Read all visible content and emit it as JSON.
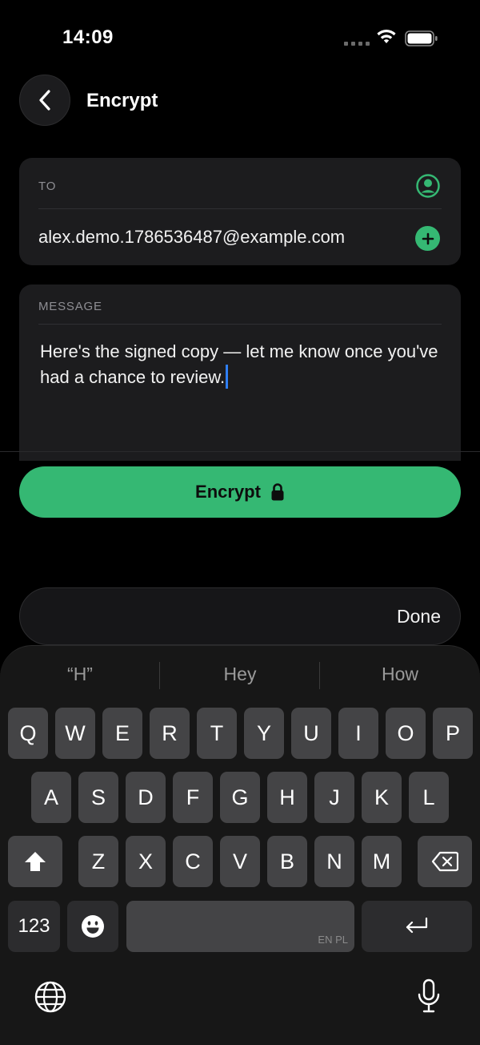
{
  "status_bar": {
    "time": "14:09"
  },
  "header": {
    "title": "Encrypt"
  },
  "to_card": {
    "label": "TO",
    "recipient": "alex.demo.1786536487@example.com"
  },
  "message_card": {
    "label": "MESSAGE",
    "text": "Here's the signed copy — let me know once you've had a chance to review."
  },
  "encrypt_button": {
    "label": "Encrypt"
  },
  "keyboard_toolbar": {
    "done_label": "Done"
  },
  "keyboard": {
    "suggestions": [
      "“H”",
      "Hey",
      "How"
    ],
    "row1": [
      "Q",
      "W",
      "E",
      "R",
      "T",
      "Y",
      "U",
      "I",
      "O",
      "P"
    ],
    "row2": [
      "A",
      "S",
      "D",
      "F",
      "G",
      "H",
      "J",
      "K",
      "L"
    ],
    "row3": [
      "Z",
      "X",
      "C",
      "V",
      "B",
      "N",
      "M"
    ],
    "numbers_key": "123",
    "space_sublabel": "EN PL"
  },
  "colors": {
    "accent": "#35b873",
    "background": "#000000",
    "card": "#1c1c1e",
    "caret": "#2f7ff6"
  },
  "icons": [
    "back-chevron-icon",
    "contact-icon",
    "add-icon",
    "lock-icon",
    "shift-icon",
    "backspace-icon",
    "emoji-icon",
    "return-icon",
    "globe-icon",
    "microphone-icon"
  ]
}
